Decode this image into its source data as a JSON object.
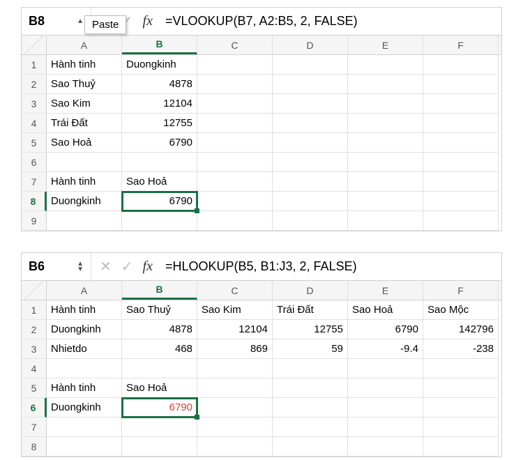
{
  "columns": [
    "A",
    "B",
    "C",
    "D",
    "E",
    "F"
  ],
  "sheet1": {
    "selected_cell": "B8",
    "paste_label": "Paste",
    "formula": "=VLOOKUP(B7, A2:B5, 2, FALSE)",
    "sel_row": "8",
    "sel_col": "B",
    "rows": {
      "1": {
        "A": "Hành tinh",
        "B": "Duongkinh"
      },
      "2": {
        "A": "Sao Thuỷ",
        "B": "4878"
      },
      "3": {
        "A": "Sao Kim",
        "B": "12104"
      },
      "4": {
        "A": "Trái Đất",
        "B": "12755"
      },
      "5": {
        "A": "Sao Hoả",
        "B": "6790"
      },
      "7": {
        "A": "Hành tinh",
        "B": "Sao Hoả"
      },
      "8": {
        "A": "Duongkinh",
        "B": "6790"
      }
    },
    "row_order": [
      "1",
      "2",
      "3",
      "4",
      "5",
      "6",
      "7",
      "8",
      "9"
    ],
    "numeric_cells": [
      "2.B",
      "3.B",
      "4.B",
      "5.B",
      "8.B"
    ]
  },
  "sheet2": {
    "selected_cell": "B6",
    "formula": "=HLOOKUP(B5, B1:J3, 2, FALSE)",
    "sel_row": "6",
    "sel_col": "B",
    "rows": {
      "1": {
        "A": "Hành tinh",
        "B": "Sao Thuỷ",
        "C": "Sao Kim",
        "D": "Trái Đất",
        "E": "Sao Hoả",
        "F": "Sao Mộc"
      },
      "2": {
        "A": "Duongkinh",
        "B": "4878",
        "C": "12104",
        "D": "12755",
        "E": "6790",
        "F": "142796"
      },
      "3": {
        "A": "Nhietdo",
        "B": "468",
        "C": "869",
        "D": "59",
        "E": "-9.4",
        "F": "-238"
      },
      "5": {
        "A": "Hành tinh",
        "B": "Sao Hoả"
      },
      "6": {
        "A": "Duongkinh",
        "B": "6790"
      }
    },
    "row_order": [
      "1",
      "2",
      "3",
      "4",
      "5",
      "6",
      "7",
      "8"
    ],
    "numeric_cells": [
      "2.B",
      "2.C",
      "2.D",
      "2.E",
      "2.F",
      "3.B",
      "3.C",
      "3.D",
      "3.E",
      "3.F",
      "6.B"
    ],
    "red_cells": [
      "6.B"
    ]
  }
}
